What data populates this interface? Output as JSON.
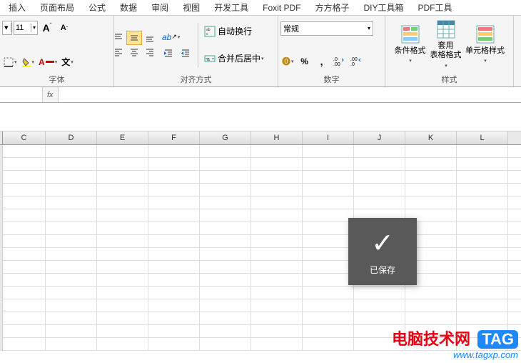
{
  "tabs": [
    "插入",
    "页面布局",
    "公式",
    "数据",
    "审阅",
    "视图",
    "开发工具",
    "Foxit PDF",
    "方方格子",
    "DIY工具箱",
    "PDF工具"
  ],
  "ribbon": {
    "font": {
      "label": "字体",
      "size": "11",
      "increase": "A",
      "decrease": "A"
    },
    "align": {
      "label": "对齐方式",
      "wrap": "自动换行",
      "merge": "合并后居中"
    },
    "number": {
      "label": "数字",
      "format": "常规"
    },
    "styles": {
      "label": "样式",
      "conditional": "条件格式",
      "table": "套用\n表格格式",
      "cell": "单元格样式"
    }
  },
  "columns": [
    "C",
    "D",
    "E",
    "F",
    "G",
    "H",
    "I",
    "J",
    "K",
    "L"
  ],
  "toast": "已保存",
  "watermark": {
    "brand": "电脑技术网",
    "tag": "TAG",
    "url": "www.tagxp.com"
  }
}
